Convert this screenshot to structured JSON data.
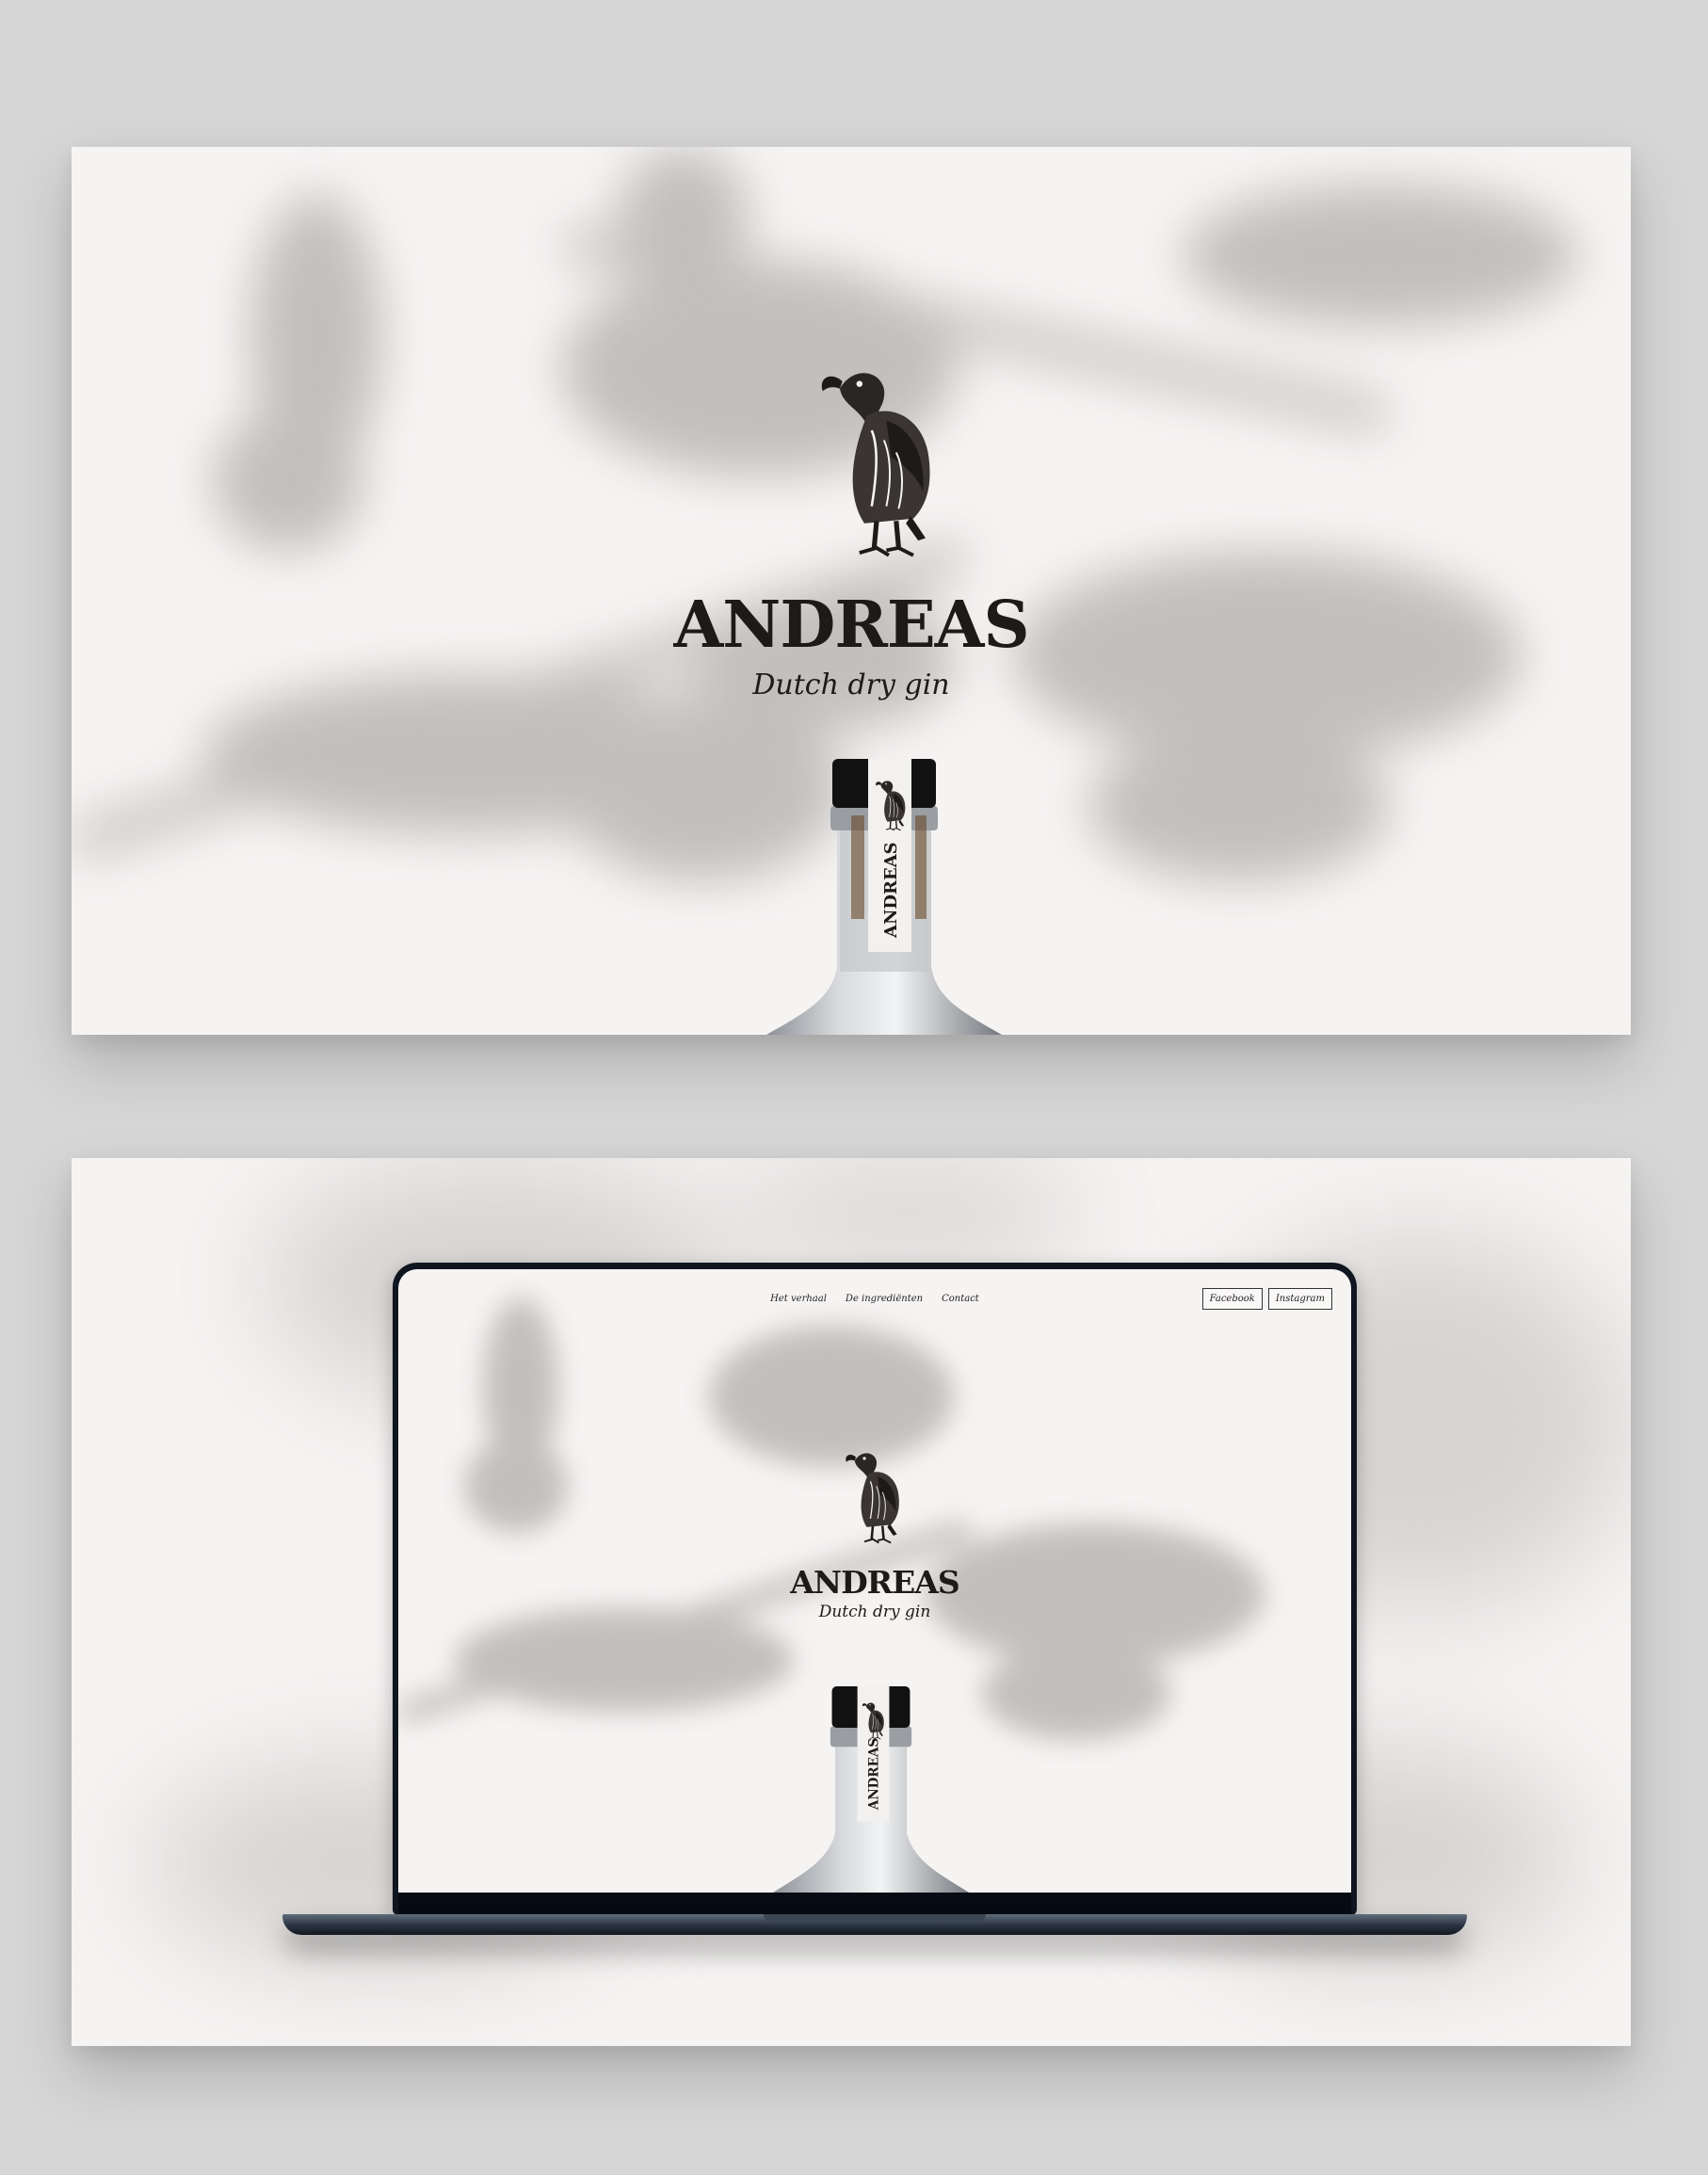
{
  "brand": {
    "name": "ANDREAS",
    "tagline": "Dutch dry gin",
    "bottle_label": "ANDREAS"
  },
  "mockup": {
    "nav": [
      {
        "label": "Het verhaal"
      },
      {
        "label": "De ingrediënten"
      },
      {
        "label": "Contact"
      }
    ],
    "social": [
      {
        "label": "Facebook"
      },
      {
        "label": "Instagram"
      }
    ]
  },
  "colors": {
    "page_bg": "#d6d6d6",
    "panel_bg": "#f6f4f3",
    "ink": "#1d1a18",
    "laptop_frame": "#0f1620"
  },
  "icons": {
    "logo": "vulture-icon"
  }
}
